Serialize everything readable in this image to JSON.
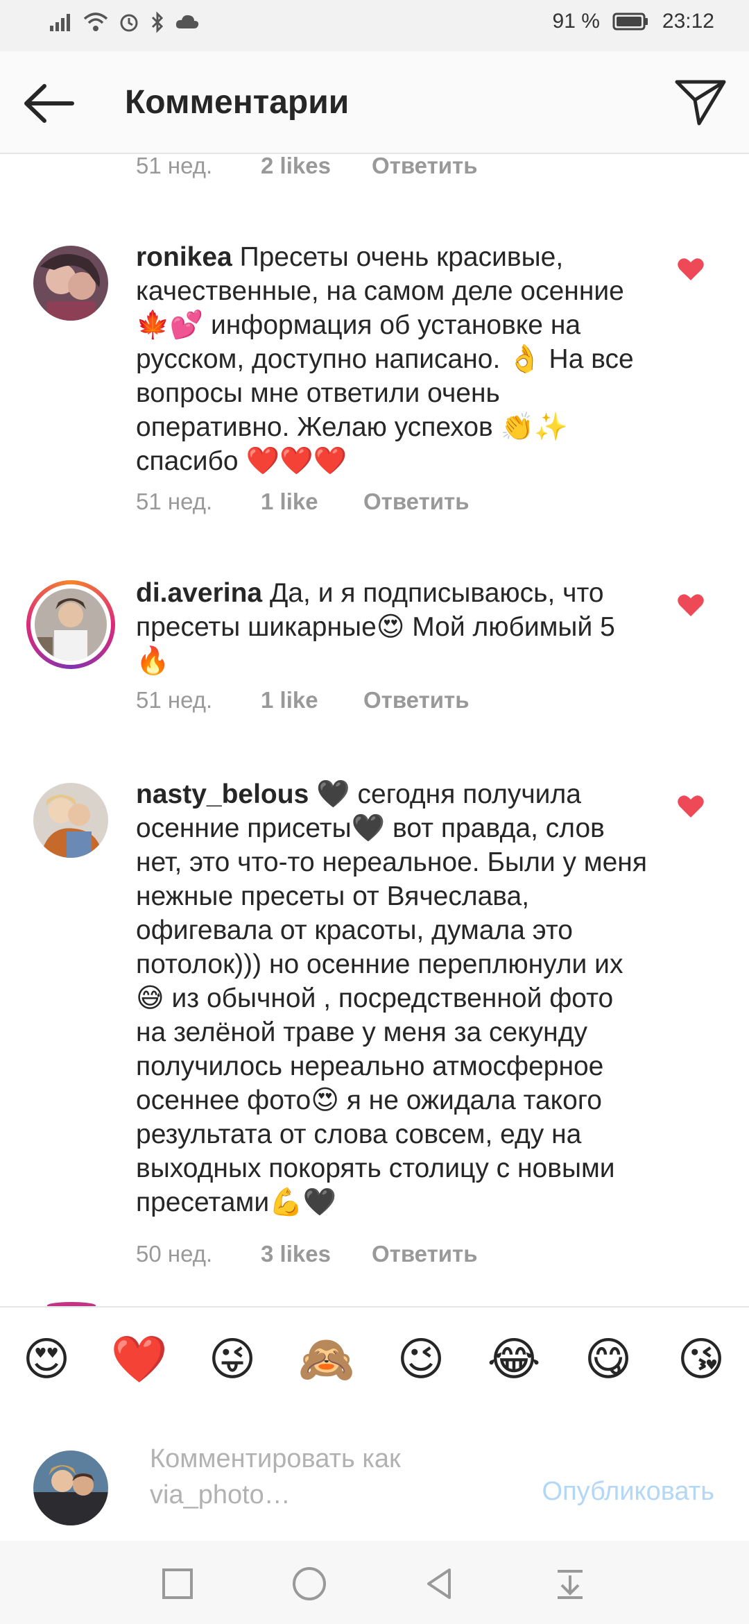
{
  "status": {
    "battery": "91 %",
    "time": "23:12"
  },
  "header": {
    "title": "Комментарии"
  },
  "comments": [
    {
      "time": "51 нед.",
      "likes": "2 likes",
      "reply": "Ответить"
    },
    {
      "user": "ronikea",
      "text": "Пресеты очень красивые, качественные, на самом деле осенние 🍁💕 информация об установке на русском, доступно написано. 👌 На все вопросы мне ответили очень оперативно. Желаю успехов 👏✨ спасибо ❤️❤️❤️",
      "time": "51 нед.",
      "likes": "1 like",
      "reply": "Ответить"
    },
    {
      "user": "di.averina",
      "text": "Да, и я подписываюсь, что пресеты шикарные😍 Мой любимый 5 🔥",
      "time": "51 нед.",
      "likes": "1 like",
      "reply": "Ответить"
    },
    {
      "user": "nasty_belous",
      "text": "🖤 сегодня получила осенние присеты🖤 вот правда, слов нет, это что-то нереальное. Были у меня нежные пресеты от Вячеслава, офигевала от красоты, думала это потолок))) но осенние переплюнули их😅 из обычной , посредственной фото на зелёной траве у меня за секунду получилось нереально атмосферное осеннее фото😍 я не ожидала такого результата от слова совсем, еду на выходных покорять столицу с новыми пресетами💪🖤",
      "time": "50 нед.",
      "likes": "3 likes",
      "reply": "Ответить"
    }
  ],
  "emoji_bar": [
    "😍",
    "❤️",
    "😜",
    "🙈",
    "😉",
    "😂",
    "😋",
    "😘"
  ],
  "input": {
    "placeholder": "Комментировать как via_photo…",
    "publish_label": "Опубликовать"
  },
  "colors": {
    "heart": "#ed4956",
    "publish": "#b3d7f7"
  },
  "icons": {
    "back": "arrow-left",
    "send": "paper-plane",
    "heart": "heart",
    "nav": [
      "square",
      "circle",
      "triangle-back",
      "download-arrow"
    ]
  }
}
